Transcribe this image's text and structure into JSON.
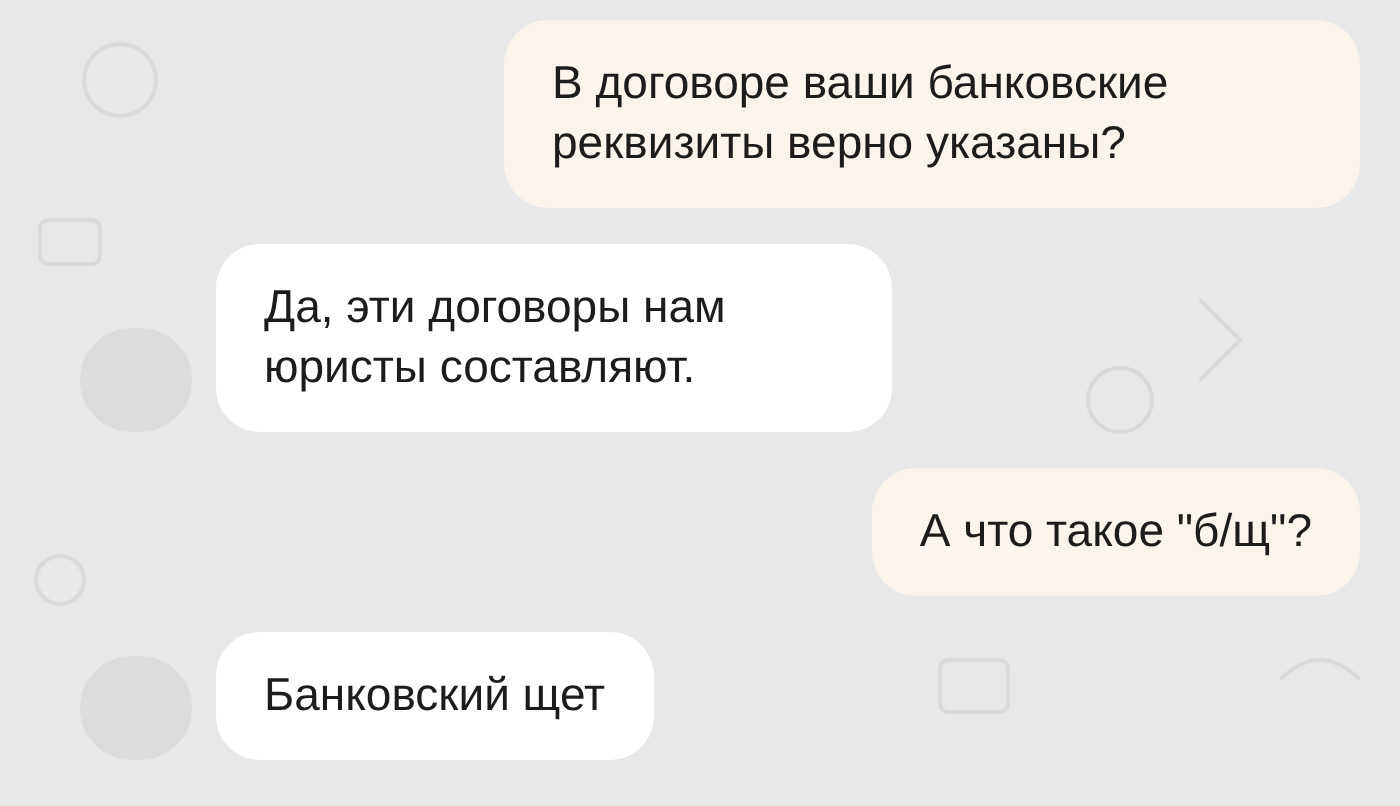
{
  "messages": [
    {
      "kind": "outgoing",
      "text": "В договоре ваши банковские реквизиты верно указаны?"
    },
    {
      "kind": "incoming",
      "text": "Да, эти договоры нам юристы составляют."
    },
    {
      "kind": "outgoing",
      "text": "А что такое \"б/щ\"?"
    },
    {
      "kind": "incoming",
      "text": "Банковский щет"
    }
  ]
}
